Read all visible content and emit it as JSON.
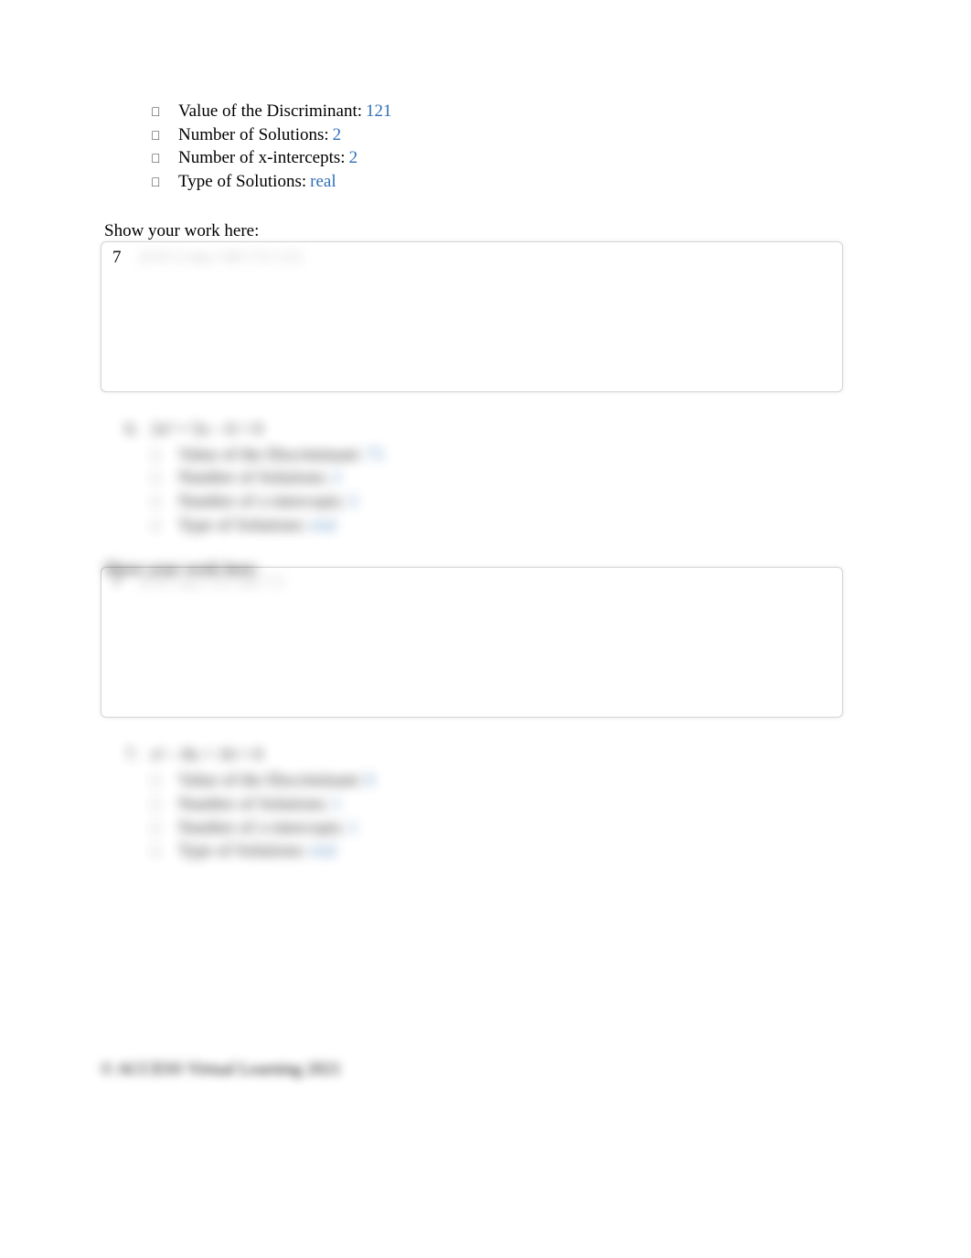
{
  "section1": {
    "items": [
      {
        "label": "Value of the Discriminant:",
        "value": "121"
      },
      {
        "label": "Number of Solutions:",
        "value": "2"
      },
      {
        "label": "Number of x-intercepts:",
        "value": "2"
      },
      {
        "label": "Type of Solutions:",
        "value": "real"
      }
    ]
  },
  "work1": {
    "header": "Show your work here:",
    "number": "7",
    "expression": "d=b^2-4ac=49+72=121"
  },
  "problem6": {
    "number": "6.",
    "equation": "2x² + 5x – 6 = 0",
    "items": [
      {
        "label": "Value of the Discriminant:",
        "value": "73"
      },
      {
        "label": "Number of Solutions:",
        "value": "2"
      },
      {
        "label": "Number of x-intercepts:",
        "value": "2"
      },
      {
        "label": "Type of Solutions:",
        "value": "real"
      }
    ]
  },
  "work2": {
    "header": "Show your work here:",
    "number": "7",
    "expression": "d=b²-4ac=25+48=73"
  },
  "problem7": {
    "number": "7.",
    "equation": "x² – 8x + 16 = 0",
    "items": [
      {
        "label": "Value of the Discriminant:",
        "value": "0"
      },
      {
        "label": "Number of Solutions:",
        "value": "1"
      },
      {
        "label": "Number of x-intercepts:",
        "value": "1"
      },
      {
        "label": "Type of Solutions:",
        "value": "real"
      }
    ]
  },
  "footer": "© ACCESS Virtual Learning 2021"
}
